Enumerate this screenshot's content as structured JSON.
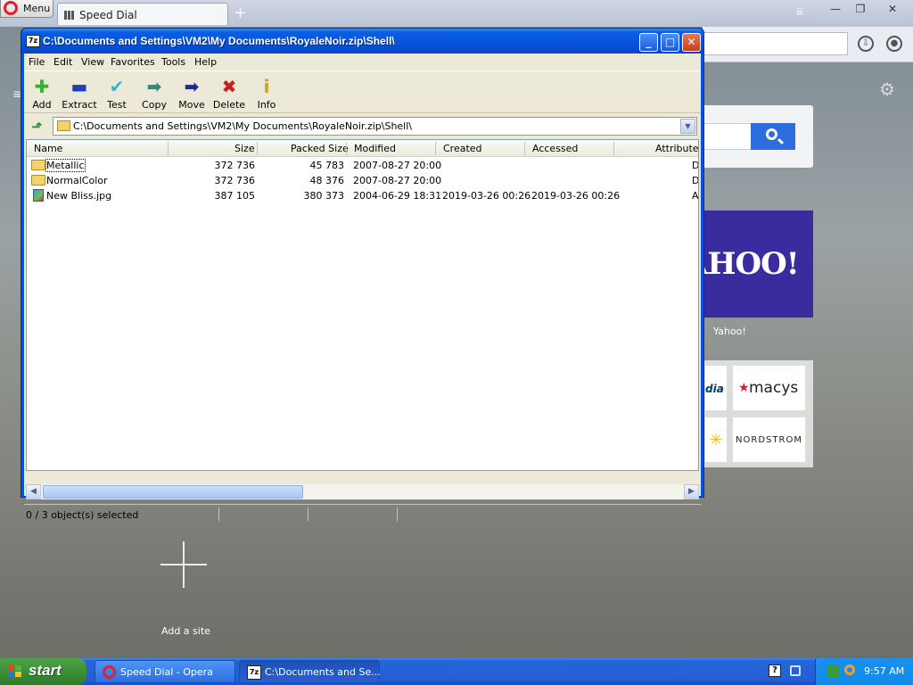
{
  "browser": {
    "menu_label": "Menu",
    "tab_title": "Speed Dial",
    "new_tab_symbol": "+",
    "tab_menu_symbol": "⩸",
    "window_controls": {
      "minimize": "—",
      "restore": "❐",
      "close": "✕"
    },
    "download_symbol": "⇩",
    "account_symbol": "●"
  },
  "speed_dial": {
    "settings_symbol": "⚙",
    "yahoo_logo": "AHOO!",
    "yahoo_label": "Yahoo!",
    "partial_tile_text": "dia",
    "macys_star": "★",
    "macys_text": "macys",
    "walmart_spark": "✳",
    "nordstrom_text": "NORDSTROM",
    "add_site_label": "Add a site"
  },
  "zip_window": {
    "title": "C:\\Documents and Settings\\VM2\\My Documents\\RoyaleNoir.zip\\Shell\\",
    "app_icon_text": "7z",
    "caption_buttons": {
      "minimize": "_",
      "maximize": "□",
      "close": "✕"
    },
    "menu": [
      "File",
      "Edit",
      "View",
      "Favorites",
      "Tools",
      "Help"
    ],
    "toolbar": [
      {
        "label": "Add",
        "icon": "plus-icon",
        "symbol": "✚",
        "color": "#2db52d"
      },
      {
        "label": "Extract",
        "icon": "minus-icon",
        "symbol": "▬",
        "color": "#1e3fb8"
      },
      {
        "label": "Test",
        "icon": "check-icon",
        "symbol": "✔",
        "color": "#31b8c9"
      },
      {
        "label": "Copy",
        "icon": "copy-arrow-icon",
        "symbol": "➡",
        "color": "#2d8a7e"
      },
      {
        "label": "Move",
        "icon": "move-arrow-icon",
        "symbol": "➡",
        "color": "#1a2a9c"
      },
      {
        "label": "Delete",
        "icon": "delete-x-icon",
        "symbol": "✖",
        "color": "#d01c1c"
      },
      {
        "label": "Info",
        "icon": "info-icon",
        "symbol": "i",
        "color": "#c9a21b"
      }
    ],
    "up_symbol": "⬏",
    "path": "C:\\Documents and Settings\\VM2\\My Documents\\RoyaleNoir.zip\\Shell\\",
    "dropdown_symbol": "▼",
    "columns": {
      "name": "Name",
      "size": "Size",
      "packed": "Packed Size",
      "modified": "Modified",
      "created": "Created",
      "accessed": "Accessed",
      "attributes": "Attributes"
    },
    "rows": [
      {
        "name": "Metallic",
        "type": "folder",
        "size": "372 736",
        "packed": "45 783",
        "modified": "2007-08-27 20:00",
        "created": "",
        "accessed": "",
        "attributes": "D"
      },
      {
        "name": "NormalColor",
        "type": "folder",
        "size": "372 736",
        "packed": "48 376",
        "modified": "2007-08-27 20:00",
        "created": "",
        "accessed": "",
        "attributes": "D"
      },
      {
        "name": "New Bliss.jpg",
        "type": "image",
        "size": "387 105",
        "packed": "380 373",
        "modified": "2004-06-29 18:31",
        "created": "2019-03-26 00:26",
        "accessed": "2019-03-26 00:26",
        "attributes": "A"
      }
    ],
    "scroll_left": "◀",
    "scroll_right": "▶",
    "status": "0 / 3 object(s) selected"
  },
  "taskbar": {
    "start_label": "start",
    "tasks": [
      {
        "label": "Speed Dial - Opera"
      },
      {
        "label": "C:\\Documents and Se..."
      }
    ],
    "help_symbol": "?",
    "clock": "9:57 AM"
  }
}
